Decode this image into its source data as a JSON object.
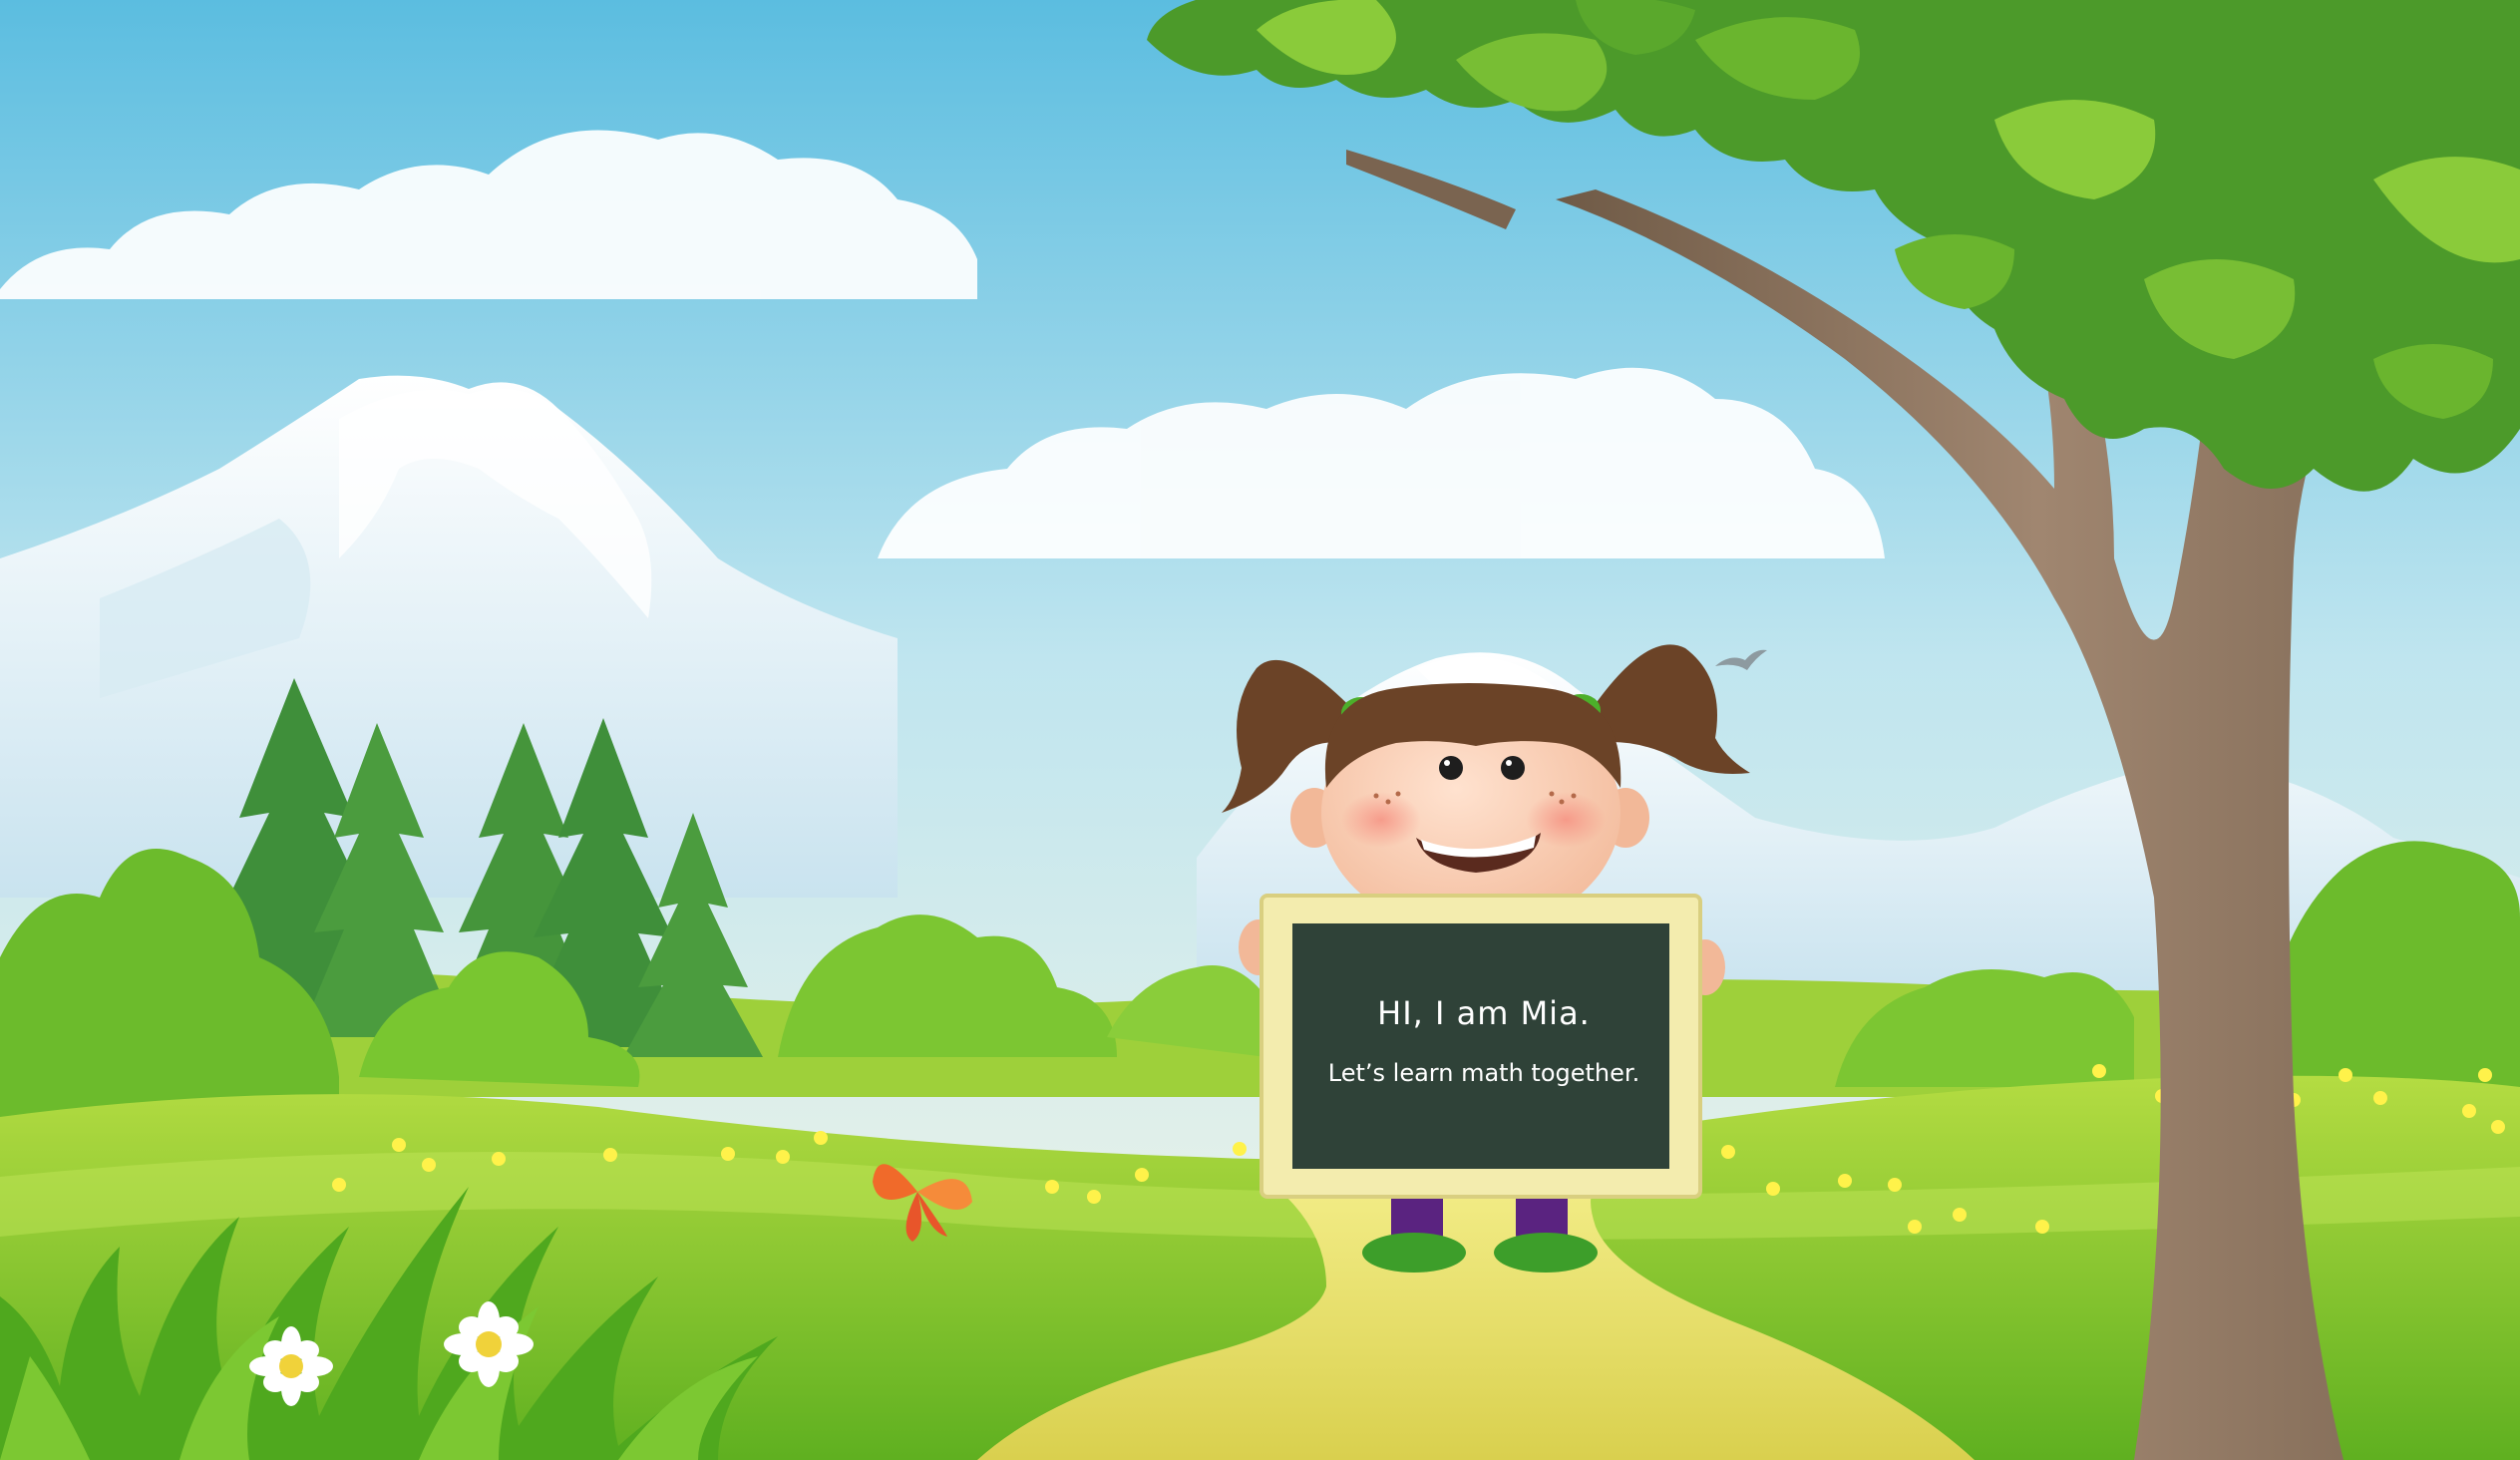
{
  "scene": {
    "character": "girl-with-pigtails",
    "sign": {
      "line1": "HI, I am Mia.",
      "line2": "Let’s learn math together."
    }
  },
  "colors": {
    "sky_top": "#5bbde0",
    "sky_bottom": "#f6f6e6",
    "grass": "#7cc42a",
    "path": "#e6df6a",
    "chalkboard": "#2f4238",
    "frame": "#f3ecae"
  }
}
